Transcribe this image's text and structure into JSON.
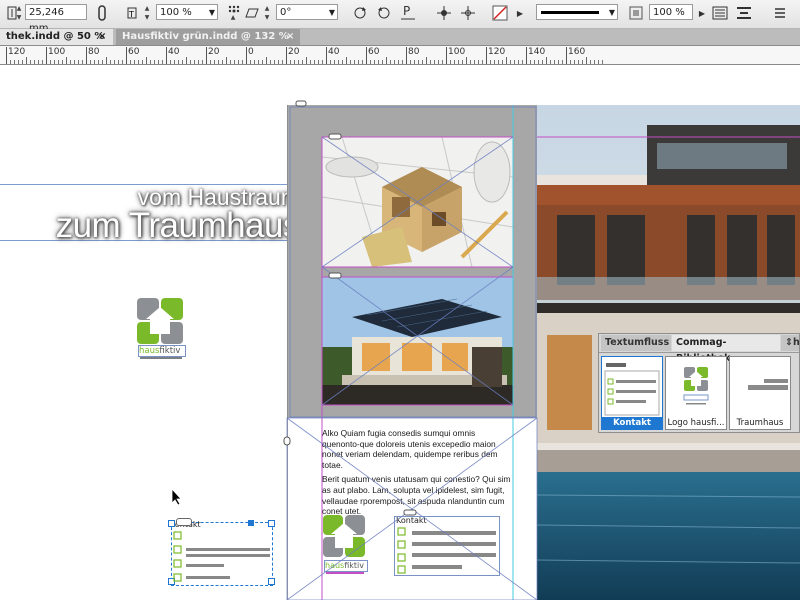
{
  "control_bar": {
    "height_label_icon": "height-icon",
    "height_value": "25,246 mm",
    "scale_value": "100 %",
    "angle_value": "0°",
    "percent_value": "100 %",
    "reference_point_icon": "reference-point-icon",
    "stroke_color": "#000000",
    "fill_none_color": "#d22222"
  },
  "tabs": [
    {
      "label": "thek.indd @ 50 %",
      "close": "×"
    },
    {
      "label": "Hausfiktiv grün.indd @ 132 %",
      "close": "×"
    }
  ],
  "ruler": {
    "labels": [
      "120",
      "100",
      "80",
      "60",
      "40",
      "20",
      "0",
      "20",
      "40",
      "60",
      "80",
      "100",
      "120",
      "140",
      "160"
    ]
  },
  "slogan": {
    "line1": "vom Haustraum",
    "line2": "zum Traumhaus"
  },
  "logo": {
    "text_part1": "haus",
    "text_part2": "fiktiv",
    "green": "#7ab929",
    "gray": "#8c8f94"
  },
  "body_text": {
    "paragraph1": "Alko Quiam fugia consedis sumqui omnis quenonto-que doloreis utenis excepedio maion nonet veriam delendam, quidempe reribus dem totae.",
    "paragraph2": "Berit quatum venis utatusam qui conestio? Qui sim as aut plabo. Lam, solupta vel ipidelest, sim fugit, vellaudae rporempost, sit aspuda nlanduntin cum conet utet."
  },
  "kontakt_label_canvas": "Kontakt",
  "kontakt_label_page": "Kontakt",
  "panel": {
    "tabs": [
      "Textumfluss",
      "Commag-Bibliothek",
      "h"
    ],
    "items": [
      "Kontakt",
      "Logo hausfi...",
      "Traumhaus"
    ],
    "selected": "Kontakt"
  },
  "colors": {
    "frame_magenta": "#c44ec4",
    "guide_cyan": "#46c8e0",
    "selection_blue": "#1e78d2",
    "green": "#7ab929"
  }
}
